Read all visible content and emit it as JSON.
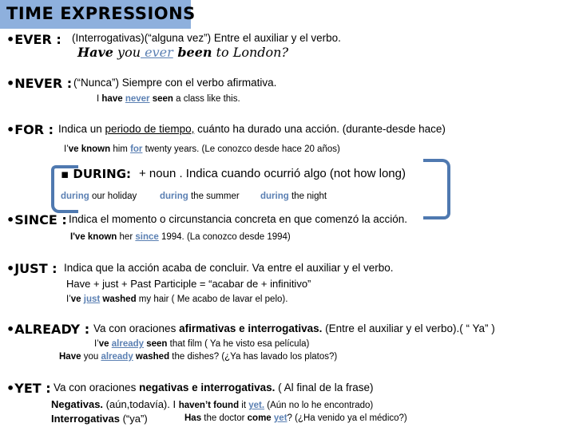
{
  "title": "TIME EXPRESSIONS",
  "accent_color": "#8eb0dd",
  "keyword_color": "#5b80b3",
  "sections": {
    "ever": {
      "heading": "•EVER :",
      "desc": "(Interrogativas)(“alguna vez”) Entre el auxiliar y el verbo.",
      "example": {
        "p1": "Have",
        "p2": " you",
        "kw": " ever",
        "p3": "  been",
        "p4": " to London?"
      }
    },
    "never": {
      "heading": "•NEVER :",
      "desc": "(“Nunca”) Siempre con el verbo afirmativa.",
      "example": {
        "p1": "I",
        "p2": "have",
        "kw": "never",
        "p3": "seen",
        "p4": " a  class  like  this."
      }
    },
    "for": {
      "heading": "•FOR :",
      "desc_pre": "Indica un ",
      "desc_ul": "periodo de tiempo,",
      "desc_post": " cuánto ha durado una acción. (durante-desde hace)",
      "example": {
        "p1": "I’",
        "p2": "ve  known",
        "p3": " him ",
        "kw": "for",
        "p4": " twenty years.   (Le conozco desde hace 20 años)"
      }
    },
    "during": {
      "heading": "▪ DURING:",
      "desc": "+ noun . Indica cuando ocurrió algo (not how long)",
      "examples": [
        {
          "kw": "during",
          "text": " our holiday"
        },
        {
          "kw": "during",
          "text": " the summer"
        },
        {
          "kw": "during",
          "text": " the night"
        }
      ]
    },
    "since": {
      "heading": "•SINCE :",
      "desc": "Indica el momento o circunstancia concreta en que comenzó la acción.",
      "example": {
        "p1": "I've  known",
        "p2": "  her ",
        "kw": "since",
        "p3": " 1994.   (La conozco desde 1994)"
      }
    },
    "just": {
      "heading": "•JUST :",
      "desc": "Indica que la acción acaba de concluir. Va entre el auxiliar y el verbo.",
      "formula": "Have + just + Past Participle = “acabar de + infinitivo”",
      "example": {
        "p1": "I’",
        "p2": "ve",
        "kw": "just",
        "p3": "washed",
        "p4": "  my hair   ( Me acabo de lavar el pelo)."
      }
    },
    "already": {
      "heading": "•ALREADY :",
      "desc_pre": "Va con oraciones ",
      "desc_bold": "afirmativas e interrogativas.",
      "desc_post": " (Entre el auxiliar y el verbo).( “ Ya” )",
      "example1": {
        "p1": "I’",
        "p2": "ve",
        "kw": "already",
        "p3": "seen",
        "p4": "  that  film        ( Ya he visto esa película)"
      },
      "example2": {
        "p1": "Have",
        "p2": " you ",
        "kw": "already",
        "p3": "washed",
        "p4": "  the  dishes?    (¿Ya has lavado los platos?)"
      }
    },
    "yet": {
      "heading": "•YET :",
      "desc_pre": "Va con oraciones ",
      "desc_bold": "negativas e interrogativas.",
      "desc_post": "  ( Al final de la frase)",
      "neg_label": "Negativas.",
      "neg_desc": " (aún,todavía). I ",
      "neg_b": "haven’t  found",
      "neg_mid": "  it  ",
      "neg_kw": "yet.",
      "neg_post": " (Aún no lo he encontrado)",
      "int_label": "Interrogativas",
      "int_desc": "  (“ya”)",
      "int_b1": "Has",
      "int_mid": "  the doctor ",
      "int_b2": "come",
      "int_kw": "yet",
      "int_post": "? (¿Ha venido ya el médico?)"
    }
  }
}
